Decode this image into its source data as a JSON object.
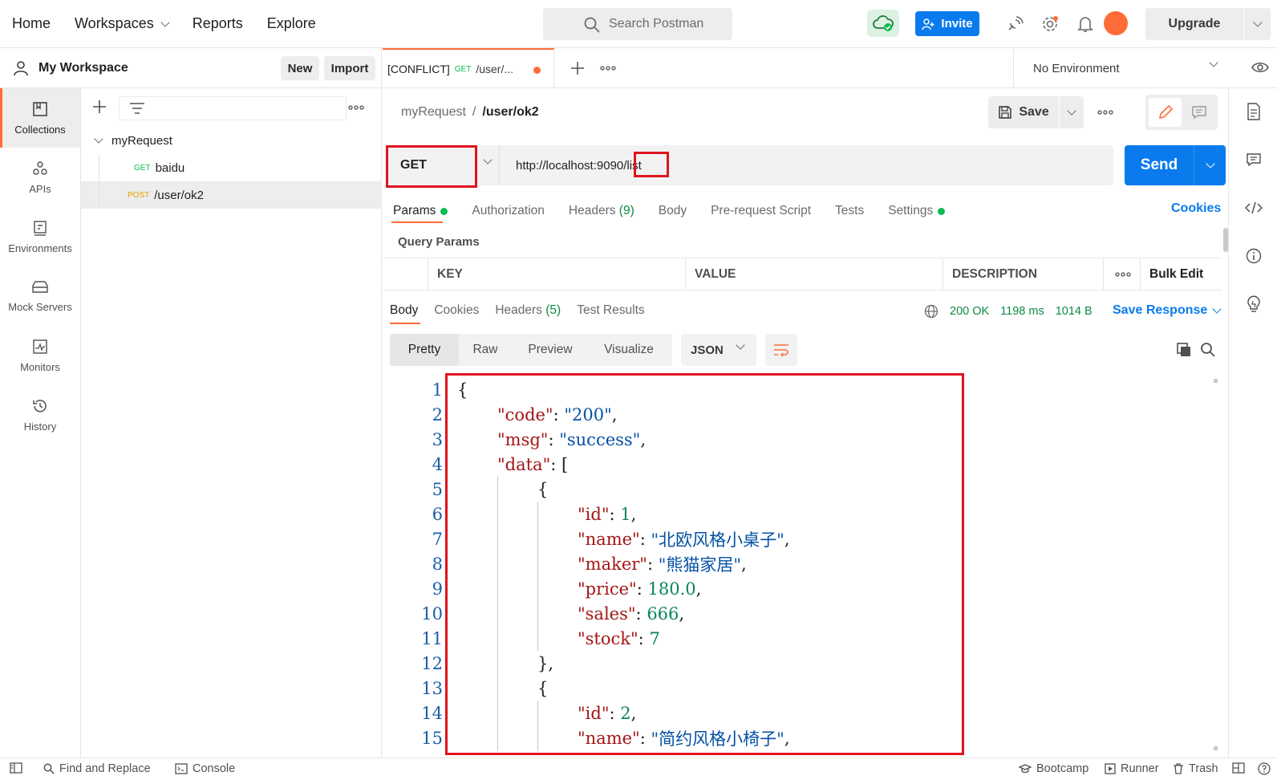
{
  "topnav": {
    "home": "Home",
    "workspaces": "Workspaces",
    "reports": "Reports",
    "explore": "Explore",
    "search_placeholder": "Search Postman",
    "invite": "Invite",
    "upgrade": "Upgrade"
  },
  "workspace": {
    "title": "My Workspace",
    "new_label": "New",
    "import_label": "Import"
  },
  "rail": [
    {
      "label": "Collections",
      "icon": "collections-icon"
    },
    {
      "label": "APIs",
      "icon": "apis-icon"
    },
    {
      "label": "Environments",
      "icon": "environments-icon"
    },
    {
      "label": "Mock Servers",
      "icon": "mock-servers-icon"
    },
    {
      "label": "Monitors",
      "icon": "monitors-icon"
    },
    {
      "label": "History",
      "icon": "history-icon"
    }
  ],
  "tree": {
    "collection": "myRequest",
    "items": [
      {
        "method": "GET",
        "name": "baidu"
      },
      {
        "method": "POST",
        "name": "/user/ok2"
      }
    ]
  },
  "tab": {
    "conflict": "[CONFLICT]",
    "method": "GET",
    "name": "/user/..."
  },
  "environment": "No Environment",
  "request": {
    "breadcrumb_parent": "myRequest",
    "breadcrumb_sep": "/",
    "breadcrumb_current": "/user/ok2",
    "save_label": "Save",
    "method": "GET",
    "url_base": "http://localhost:9090",
    "url_path": "/list",
    "send_label": "Send",
    "tabs": [
      "Params",
      "Authorization",
      "Headers",
      "Body",
      "Pre-request Script",
      "Tests",
      "Settings"
    ],
    "headers_count": "(9)",
    "cookies_label": "Cookies",
    "query_params_label": "Query Params",
    "columns": [
      "KEY",
      "VALUE",
      "DESCRIPTION"
    ],
    "bulk_edit": "Bulk Edit"
  },
  "response": {
    "tabs": [
      "Body",
      "Cookies",
      "Headers",
      "Test Results"
    ],
    "headers_count": "(5)",
    "status": "200 OK",
    "time": "1198 ms",
    "size": "1014 B",
    "save_response": "Save Response",
    "formats": [
      "Pretty",
      "Raw",
      "Preview",
      "Visualize"
    ],
    "language": "JSON",
    "lines": [
      {
        "n": "1",
        "indent": 0,
        "tokens": [
          [
            "p",
            "{"
          ]
        ]
      },
      {
        "n": "2",
        "indent": 1,
        "tokens": [
          [
            "k",
            "\"code\""
          ],
          [
            "p",
            ": "
          ],
          [
            "s",
            "\"200\""
          ],
          [
            "p",
            ","
          ]
        ]
      },
      {
        "n": "3",
        "indent": 1,
        "tokens": [
          [
            "k",
            "\"msg\""
          ],
          [
            "p",
            ": "
          ],
          [
            "s",
            "\"success\""
          ],
          [
            "p",
            ","
          ]
        ]
      },
      {
        "n": "4",
        "indent": 1,
        "tokens": [
          [
            "k",
            "\"data\""
          ],
          [
            "p",
            ": ["
          ]
        ]
      },
      {
        "n": "5",
        "indent": 2,
        "tokens": [
          [
            "p",
            "{"
          ]
        ]
      },
      {
        "n": "6",
        "indent": 3,
        "tokens": [
          [
            "k",
            "\"id\""
          ],
          [
            "p",
            ": "
          ],
          [
            "n",
            "1"
          ],
          [
            "p",
            ","
          ]
        ]
      },
      {
        "n": "7",
        "indent": 3,
        "tokens": [
          [
            "k",
            "\"name\""
          ],
          [
            "p",
            ": "
          ],
          [
            "s",
            "\"北欧风格小桌子\""
          ],
          [
            "p",
            ","
          ]
        ]
      },
      {
        "n": "8",
        "indent": 3,
        "tokens": [
          [
            "k",
            "\"maker\""
          ],
          [
            "p",
            ": "
          ],
          [
            "s",
            "\"熊猫家居\""
          ],
          [
            "p",
            ","
          ]
        ]
      },
      {
        "n": "9",
        "indent": 3,
        "tokens": [
          [
            "k",
            "\"price\""
          ],
          [
            "p",
            ": "
          ],
          [
            "n",
            "180.0"
          ],
          [
            "p",
            ","
          ]
        ]
      },
      {
        "n": "10",
        "indent": 3,
        "tokens": [
          [
            "k",
            "\"sales\""
          ],
          [
            "p",
            ": "
          ],
          [
            "n",
            "666"
          ],
          [
            "p",
            ","
          ]
        ]
      },
      {
        "n": "11",
        "indent": 3,
        "tokens": [
          [
            "k",
            "\"stock\""
          ],
          [
            "p",
            ": "
          ],
          [
            "n",
            "7"
          ]
        ]
      },
      {
        "n": "12",
        "indent": 2,
        "tokens": [
          [
            "p",
            "},"
          ]
        ]
      },
      {
        "n": "13",
        "indent": 2,
        "tokens": [
          [
            "p",
            "{"
          ]
        ]
      },
      {
        "n": "14",
        "indent": 3,
        "tokens": [
          [
            "k",
            "\"id\""
          ],
          [
            "p",
            ": "
          ],
          [
            "n",
            "2"
          ],
          [
            "p",
            ","
          ]
        ]
      },
      {
        "n": "15",
        "indent": 3,
        "tokens": [
          [
            "k",
            "\"name\""
          ],
          [
            "p",
            ": "
          ],
          [
            "s",
            "\"简约风格小椅子\""
          ],
          [
            "p",
            ","
          ]
        ]
      }
    ]
  },
  "statusbar": {
    "find_replace": "Find and Replace",
    "console": "Console",
    "bootcamp": "Bootcamp",
    "runner": "Runner",
    "trash": "Trash"
  },
  "colors": {
    "accent": "#ff6c37",
    "primary": "#097bed",
    "highlight_box": "#e0141e",
    "success": "#0cbb52"
  }
}
